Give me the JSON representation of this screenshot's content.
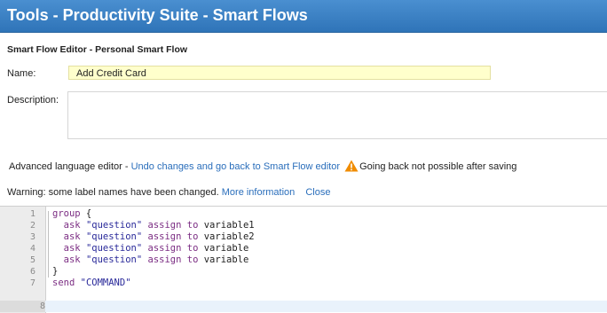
{
  "header": {
    "title": "Tools - Productivity Suite - Smart Flows"
  },
  "editor_heading": "Smart Flow Editor - Personal Smart Flow",
  "form": {
    "name_label": "Name:",
    "name_value": "Add Credit Card",
    "description_label": "Description:",
    "description_value": ""
  },
  "advanced": {
    "prefix": "Advanced language editor - ",
    "undo_link": "Undo changes and go back to Smart Flow editor",
    "warning_icon": "warning-triangle-icon",
    "warning_text": "Going back not possible after saving"
  },
  "notice": {
    "text": "Warning: some label names have been changed.",
    "more_info_link": "More information",
    "close_link": "Close"
  },
  "code": {
    "lines": [
      {
        "num": "1",
        "text": "group {"
      },
      {
        "num": "2",
        "text": "  ask \"question\" assign to variable1"
      },
      {
        "num": "3",
        "text": "  ask \"question\" assign to variable2"
      },
      {
        "num": "4",
        "text": "  ask \"question\" assign to variable"
      },
      {
        "num": "5",
        "text": "  ask \"question\" assign to variable"
      },
      {
        "num": "6",
        "text": "}"
      },
      {
        "num": "7",
        "text": "send \"COMMAND\""
      },
      {
        "num": "8",
        "text": ""
      }
    ],
    "active_line": "8"
  },
  "colors": {
    "header_blue": "#2f74b8",
    "link_blue": "#2a6ebb",
    "name_field_bg": "#ffffcc",
    "warning_orange": "#f08c00"
  }
}
